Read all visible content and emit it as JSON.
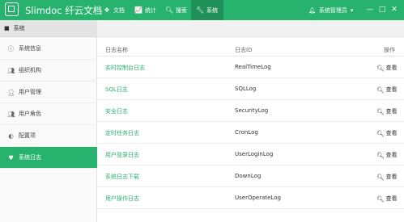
{
  "app": {
    "title": "Slimdoc 纤云文档",
    "logo_icon": "logo-icon",
    "brand_color": "#27b36e"
  },
  "nav": [
    {
      "label": "文档",
      "icon": "cubes-icon"
    },
    {
      "label": "统计",
      "icon": "chart-icon"
    },
    {
      "label": "搜索",
      "icon": "search-icon"
    },
    {
      "label": "系统",
      "icon": "wrench-icon",
      "active": true
    }
  ],
  "user": {
    "label": "系统管理员",
    "dropdown": "▾",
    "bell_icon": "bell-icon"
  },
  "window_controls": {
    "minimize": "—",
    "maximize": "□",
    "close": "✕"
  },
  "sidebar": {
    "header": "系统",
    "items": [
      {
        "label": "系统信息",
        "icon": "info-icon"
      },
      {
        "label": "组织机构",
        "icon": "group-icon"
      },
      {
        "label": "用户管理",
        "icon": "user-icon"
      },
      {
        "label": "用户角色",
        "icon": "users-icon"
      },
      {
        "label": "配置项",
        "icon": "toggle-icon"
      },
      {
        "label": "系统日志",
        "icon": "heartbeat-icon",
        "active": true
      }
    ]
  },
  "table": {
    "columns": {
      "name": "日志名称",
      "id": "日志ID",
      "op": "操作"
    },
    "rows": [
      {
        "name": "实时控制台日志",
        "id": "RealTimeLog",
        "op": "查看"
      },
      {
        "name": "SQL日志",
        "id": "SQLLog",
        "op": "查看"
      },
      {
        "name": "安全日志",
        "id": "SecurityLog",
        "op": "查看"
      },
      {
        "name": "定时任务日志",
        "id": "CronLog",
        "op": "查看"
      },
      {
        "name": "用户登录日志",
        "id": "UserLoginLog",
        "op": "查看"
      },
      {
        "name": "系统日志下载",
        "id": "DownLog",
        "op": "查看"
      },
      {
        "name": "用户操作日志",
        "id": "UserOperateLog",
        "op": "查看"
      }
    ]
  }
}
